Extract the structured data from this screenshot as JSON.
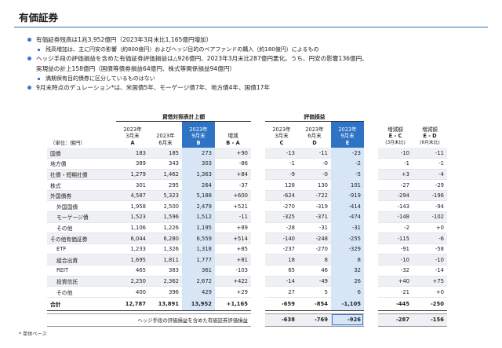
{
  "title": "有価証券",
  "bullets": [
    {
      "level": 1,
      "text": "有価証券残高は1兆3,952億円（2023年3月末比1,165億円増加）"
    },
    {
      "level": 2,
      "text": "残高増加は、主に円安の影響（約800億円）およびヘッジ目的のベアファンドの購入（約180億円）によるもの"
    },
    {
      "level": 1,
      "text": "ヘッジ手段の評価損益を含めた有価証券評価損益は△926億円、2023年3月末比287億円悪化。うち、円安の影響136億円、"
    },
    {
      "level": 1,
      "text": "実現益の計上158億円（国債等債券損益64億円、株式等関係損益94億円）",
      "cont": true
    },
    {
      "level": 2,
      "text": "満期保有目的債券に区分しているものはない"
    },
    {
      "level": 1,
      "text": "9月末時点のデュレーション*は、米国債5年、モーゲージ債7年、地方債4年、国債17年"
    }
  ],
  "table": {
    "group_headers": {
      "balance": "貸借対照表計上額",
      "valuation": "評価損益"
    },
    "unit_label": "（単位：億円）",
    "columns": [
      {
        "l1": "2023年",
        "l2": "3月末",
        "l3": "A"
      },
      {
        "l1": "2023年",
        "l2": "6月末",
        "l3": ""
      },
      {
        "l1": "2023年",
        "l2": "9月末",
        "l3": "B"
      },
      {
        "l1": "増減",
        "l2": "B - A",
        "l3": ""
      },
      {
        "l1": "2023年",
        "l2": "3月末",
        "l3": "C"
      },
      {
        "l1": "2023年",
        "l2": "6月末",
        "l3": "D"
      },
      {
        "l1": "2023年",
        "l2": "9月末",
        "l3": "E"
      },
      {
        "l1": "増減額",
        "l2": "E - C",
        "l3": "(3月末比)"
      },
      {
        "l1": "増減額",
        "l2": "E - D",
        "l3": "(6月末比)"
      }
    ],
    "rows": [
      {
        "label": "国債",
        "indent": false,
        "v": [
          "183",
          "185",
          "273",
          "+90",
          "-13",
          "-11",
          "-23",
          "-10",
          "-11"
        ]
      },
      {
        "label": "地方債",
        "indent": false,
        "v": [
          "389",
          "343",
          "303",
          "-86",
          "-1",
          "-0",
          "-2",
          "-1",
          "-1"
        ]
      },
      {
        "label": "社債・短期社債",
        "indent": false,
        "v": [
          "1,279",
          "1,462",
          "1,363",
          "+84",
          "-9",
          "-0",
          "-5",
          "+3",
          "-4"
        ]
      },
      {
        "label": "株式",
        "indent": false,
        "v": [
          "301",
          "295",
          "264",
          "-37",
          "128",
          "130",
          "101",
          "-27",
          "-29"
        ]
      },
      {
        "label": "外国債券",
        "indent": false,
        "v": [
          "4,587",
          "5,323",
          "5,188",
          "+600",
          "-624",
          "-722",
          "-919",
          "-294",
          "-196"
        ]
      },
      {
        "label": "外国国債",
        "indent": true,
        "v": [
          "1,958",
          "2,500",
          "2,479",
          "+521",
          "-270",
          "-319",
          "-414",
          "-143",
          "-94"
        ]
      },
      {
        "label": "モーゲージ債",
        "indent": true,
        "v": [
          "1,523",
          "1,596",
          "1,512",
          "-11",
          "-325",
          "-371",
          "-474",
          "-148",
          "-102"
        ]
      },
      {
        "label": "その他",
        "indent": true,
        "v": [
          "1,106",
          "1,226",
          "1,195",
          "+89",
          "-28",
          "-31",
          "-31",
          "-2",
          "+0"
        ]
      },
      {
        "label": "その他有価証券",
        "indent": false,
        "v": [
          "6,044",
          "6,280",
          "6,559",
          "+514",
          "-140",
          "-248",
          "-255",
          "-115",
          "-6"
        ]
      },
      {
        "label": "ETF",
        "indent": true,
        "v": [
          "1,233",
          "1,326",
          "1,318",
          "+85",
          "-237",
          "-270",
          "-329",
          "-91",
          "-58"
        ]
      },
      {
        "label": "組合出資",
        "indent": true,
        "v": [
          "1,695",
          "1,811",
          "1,777",
          "+81",
          "18",
          "8",
          "8",
          "-10",
          "-10"
        ]
      },
      {
        "label": "REIT",
        "indent": true,
        "v": [
          "465",
          "383",
          "361",
          "-103",
          "65",
          "46",
          "32",
          "-32",
          "-14"
        ]
      },
      {
        "label": "投資信託",
        "indent": true,
        "v": [
          "2,250",
          "2,362",
          "2,672",
          "+422",
          "-14",
          "-49",
          "26",
          "+40",
          "+75"
        ]
      },
      {
        "label": "その他",
        "indent": true,
        "v": [
          "400",
          "396",
          "429",
          "+29",
          "27",
          "5",
          "6",
          "-21",
          "+0"
        ]
      }
    ],
    "total": {
      "label": "合計",
      "v": [
        "12,787",
        "13,891",
        "13,952",
        "+1,165",
        "-659",
        "-854",
        "-1,105",
        "-445",
        "-250"
      ]
    },
    "hedge": {
      "label": "ヘッジ手段の評価損益を含めた有価証券評価損益",
      "v": [
        "-638",
        "-769",
        "-926",
        "-287",
        "-156"
      ]
    }
  },
  "footnote": "* 単体ベース",
  "colors": {
    "accent": "#2f73c5",
    "highlight": "#d7e6f6",
    "bullet": "#3c78c3",
    "row_shade": "#eef0f3"
  }
}
